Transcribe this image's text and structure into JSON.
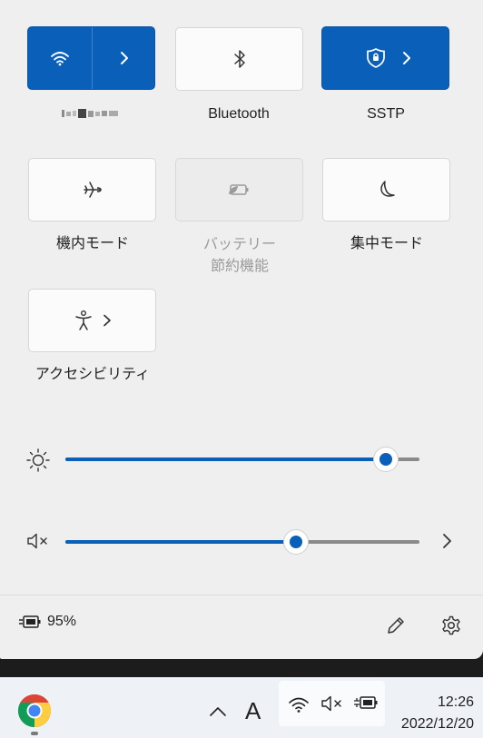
{
  "tiles": {
    "wifi": {
      "label": "",
      "active": true,
      "icon": "wifi-icon",
      "arrow_icon": "chevron-right-icon"
    },
    "bluetooth": {
      "label": "Bluetooth",
      "active": false,
      "icon": "bluetooth-icon"
    },
    "vpn": {
      "label": "SSTP",
      "active": true,
      "icon": "vpn-shield-icon",
      "arrow_icon": "chevron-right-icon"
    },
    "airplane": {
      "label": "機内モード",
      "active": false,
      "icon": "airplane-icon"
    },
    "battery_saver": {
      "label_line1": "バッテリー",
      "label_line2": "節約機能",
      "active": false,
      "disabled": true,
      "icon": "battery-saver-icon"
    },
    "focus": {
      "label": "集中モード",
      "active": false,
      "icon": "moon-icon"
    },
    "accessibility": {
      "label": "アクセシビリティ",
      "active": false,
      "icon": "accessibility-icon",
      "arrow_icon": "chevron-right-icon"
    }
  },
  "sliders": {
    "brightness": {
      "icon": "sun-icon",
      "value_fraction": 0.906
    },
    "volume": {
      "icon": "speaker-muted-icon",
      "value_fraction": 0.65,
      "trailing_icon": "chevron-right-icon"
    }
  },
  "footer": {
    "battery_icon": "battery-charging-icon",
    "battery_text": "95%",
    "edit_icon": "pencil-icon",
    "settings_icon": "gear-icon"
  },
  "taskbar": {
    "app_icon": "chrome-icon",
    "overflow_icon": "chevron-up-icon",
    "ime_text": "A",
    "tray_icons": [
      "wifi-icon",
      "speaker-muted-icon",
      "battery-charging-icon"
    ],
    "time": "12:26",
    "date": "2022/12/20"
  },
  "colors": {
    "accent": "#0a5fb8",
    "panel": "#efefef",
    "taskbar": "#eef1f5"
  }
}
